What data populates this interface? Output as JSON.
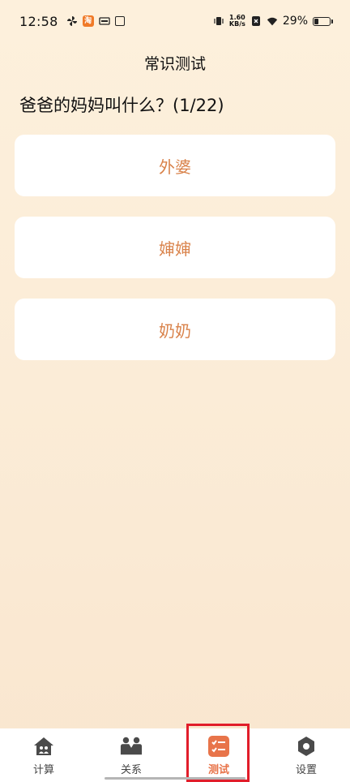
{
  "status_bar": {
    "time": "12:58",
    "taobao_label": "淘",
    "speed_value": "1.60",
    "speed_unit": "KB/s",
    "battery_text": "29%",
    "battery_level": 0.29
  },
  "page": {
    "title": "常识测试",
    "question": "爸爸的妈妈叫什么？(1/22)"
  },
  "options": [
    {
      "label": "外婆"
    },
    {
      "label": "婶婶"
    },
    {
      "label": "奶奶"
    }
  ],
  "bottom_nav": {
    "items": [
      {
        "label": "计算",
        "icon": "home-icon",
        "active": false
      },
      {
        "label": "关系",
        "icon": "people-icon",
        "active": false
      },
      {
        "label": "测试",
        "icon": "checklist-icon",
        "active": true
      },
      {
        "label": "设置",
        "icon": "settings-icon",
        "active": false
      }
    ]
  },
  "colors": {
    "accent": "#e8744a",
    "option_text": "#d9824a",
    "background": "#fdf0dc",
    "highlight": "#e11d2a"
  }
}
